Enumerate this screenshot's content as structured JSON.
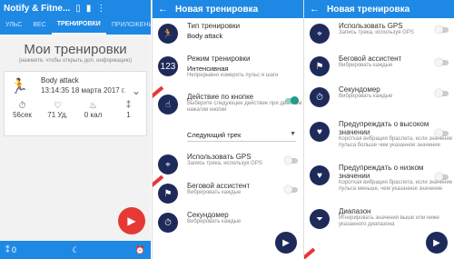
{
  "panel1": {
    "app_title": "Notify & Fitne...",
    "tabs": [
      "УЛЬС",
      "ВЕС",
      "ТРЕНИРОВКИ",
      "ПРИЛОЖЕНИЯ"
    ],
    "heading": "Мои тренировки",
    "hint": "(нажмите, чтобы открыть доп. информацию)",
    "workout": {
      "name": "Body attack",
      "datetime": "13:14:35  18 марта 2017 г.",
      "stats": [
        "56сек",
        "71 Уд.",
        "0 кал",
        "1"
      ]
    },
    "bottom": {
      "left_value": "0"
    }
  },
  "panel2": {
    "title": "Новая тренировка",
    "rows": [
      {
        "title": "Тип тренировки",
        "value": "Body attack"
      },
      {
        "title": "Режим тренировки",
        "value": "Интенсивная",
        "sub": "Непрерывно измерять пульс и шаги"
      },
      {
        "title": "Действие по кнопке",
        "sub": "Выберите следующее действие при двойном нажатии кнопки"
      },
      {
        "title": "Использовать GPS",
        "sub": "Запись трека, используя GPS"
      },
      {
        "title": "Беговой ассистент",
        "sub": "Вибрировать каждые"
      },
      {
        "title": "Секундомер",
        "sub": "Вибрировать каждые"
      }
    ],
    "dropdown": "Следующий трек"
  },
  "panel3": {
    "title": "Новая тренировка",
    "rows": [
      {
        "title": "Использовать GPS",
        "sub": "Запись трека, используя GPS"
      },
      {
        "title": "Беговой ассистент",
        "sub": "Вибрировать каждые"
      },
      {
        "title": "Секундомер",
        "sub": "Вибрировать каждые"
      },
      {
        "title": "Предупреждать о высоком значении",
        "sub": "Короткая вибрация браслета, если значение пульса больше чем указанное значение"
      },
      {
        "title": "Предупреждать о низком значении",
        "sub": "Короткая вибрация браслета, если значение пульса меньше, чем указанное значение"
      },
      {
        "title": "Диапазон",
        "sub": "Игнорировать значения выше или ниже указанного диапазона"
      }
    ]
  }
}
